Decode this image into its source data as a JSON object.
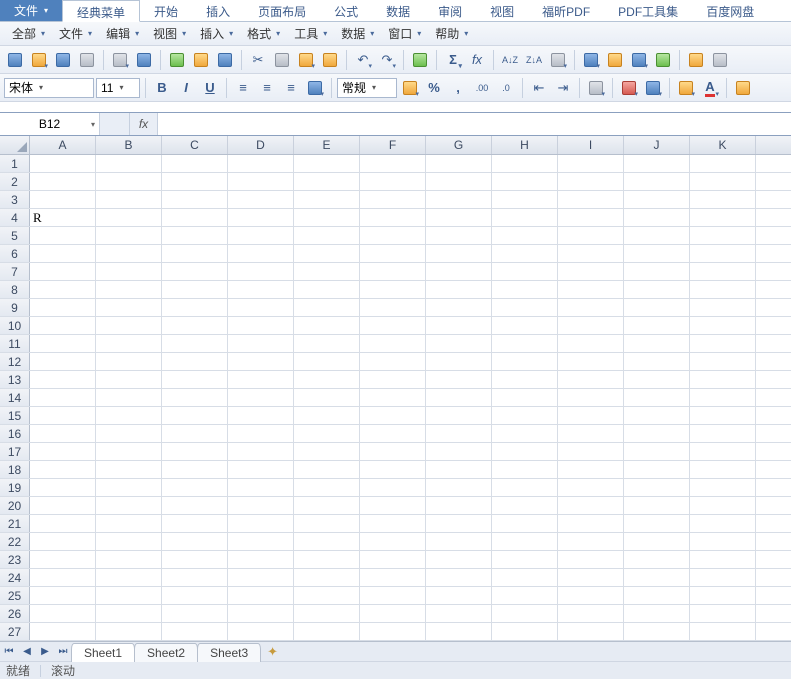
{
  "ribbon": {
    "file": "文件",
    "tabs": [
      "经典菜单",
      "开始",
      "插入",
      "页面布局",
      "公式",
      "数据",
      "审阅",
      "视图",
      "福昕PDF",
      "PDF工具集",
      "百度网盘"
    ],
    "activeIndex": 0
  },
  "menus": [
    "全部",
    "文件",
    "编辑",
    "视图",
    "插入",
    "格式",
    "工具",
    "数据",
    "窗口",
    "帮助"
  ],
  "fontName": "宋体",
  "fontSize": "11",
  "numberFormat": "常规",
  "percentSign": "%",
  "commaSign": ",",
  "sigma": "Σ",
  "azSort": "A↓Z",
  "zaSort": "Z↓A",
  "nameBox": "B12",
  "fxLabel": "fx",
  "formula": "",
  "columns": [
    "A",
    "B",
    "C",
    "D",
    "E",
    "F",
    "G",
    "H",
    "I",
    "J",
    "K"
  ],
  "rowCount": 27,
  "cells": {
    "A4": "R"
  },
  "sheets": [
    "Sheet1",
    "Sheet2",
    "Sheet3"
  ],
  "activeSheet": 0,
  "status": {
    "ready": "就绪",
    "scroll": "滚动"
  },
  "bold": "B",
  "italic": "I",
  "underline": "U"
}
